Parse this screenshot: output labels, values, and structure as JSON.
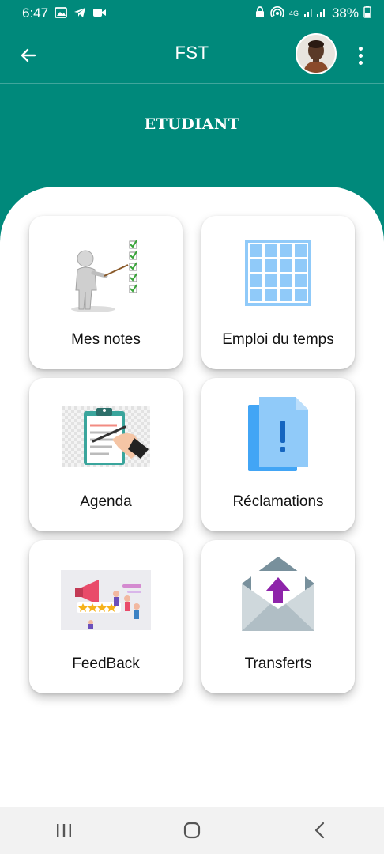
{
  "status_bar": {
    "time": "6:47",
    "network": "4G",
    "battery": "38%"
  },
  "app_bar": {
    "title": "FST"
  },
  "header": {
    "role": "ETUDIANT"
  },
  "tiles": [
    {
      "label": "Mes notes",
      "icon": "presenter-checklist-icon"
    },
    {
      "label": "Emploi du temps",
      "icon": "grid-calendar-icon"
    },
    {
      "label": "Agenda",
      "icon": "clipboard-pen-icon"
    },
    {
      "label": "Réclamations",
      "icon": "document-exclamation-icon"
    },
    {
      "label": "FeedBack",
      "icon": "megaphone-rating-icon"
    },
    {
      "label": "Transferts",
      "icon": "envelope-upload-icon"
    }
  ],
  "colors": {
    "primary": "#00897B",
    "grid_blue": "#90CAF9",
    "doc_blue": "#64B5F6",
    "arrow_purple": "#8E24AA"
  }
}
